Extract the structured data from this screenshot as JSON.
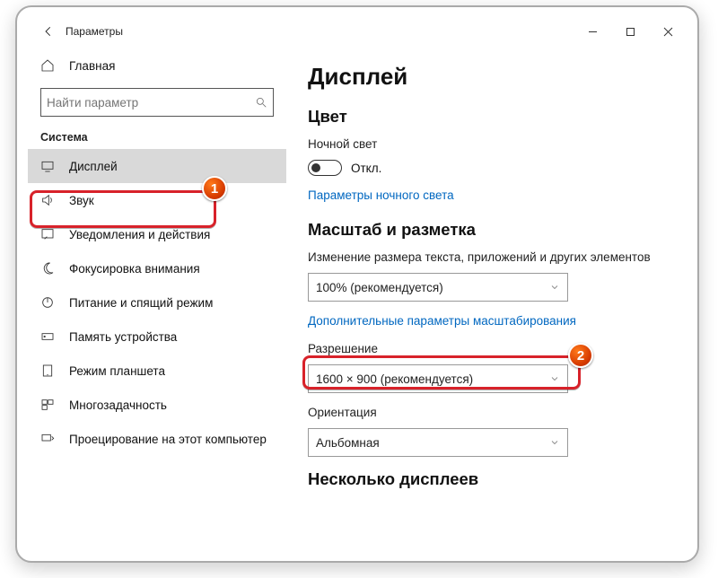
{
  "titlebar": {
    "title": "Параметры"
  },
  "sidebar": {
    "home_label": "Главная",
    "search_placeholder": "Найти параметр",
    "section_label": "Система",
    "items": [
      {
        "label": "Дисплей"
      },
      {
        "label": "Звук"
      },
      {
        "label": "Уведомления и действия"
      },
      {
        "label": "Фокусировка внимания"
      },
      {
        "label": "Питание и спящий режим"
      },
      {
        "label": "Память устройства"
      },
      {
        "label": "Режим планшета"
      },
      {
        "label": "Многозадачность"
      },
      {
        "label": "Проецирование на этот компьютер"
      }
    ]
  },
  "main": {
    "page_title": "Дисплей",
    "color": {
      "heading": "Цвет",
      "night_light_label": "Ночной свет",
      "toggle_state": "Откл.",
      "night_light_link": "Параметры ночного света"
    },
    "scale": {
      "heading": "Масштаб и разметка",
      "size_label": "Изменение размера текста, приложений и других элементов",
      "size_value": "100% (рекомендуется)",
      "advanced_link": "Дополнительные параметры масштабирования",
      "resolution_label": "Разрешение",
      "resolution_value": "1600 × 900 (рекомендуется)",
      "orientation_label": "Ориентация",
      "orientation_value": "Альбомная"
    },
    "multi": {
      "heading": "Несколько дисплеев"
    }
  },
  "annotations": {
    "badge1": "1",
    "badge2": "2"
  }
}
